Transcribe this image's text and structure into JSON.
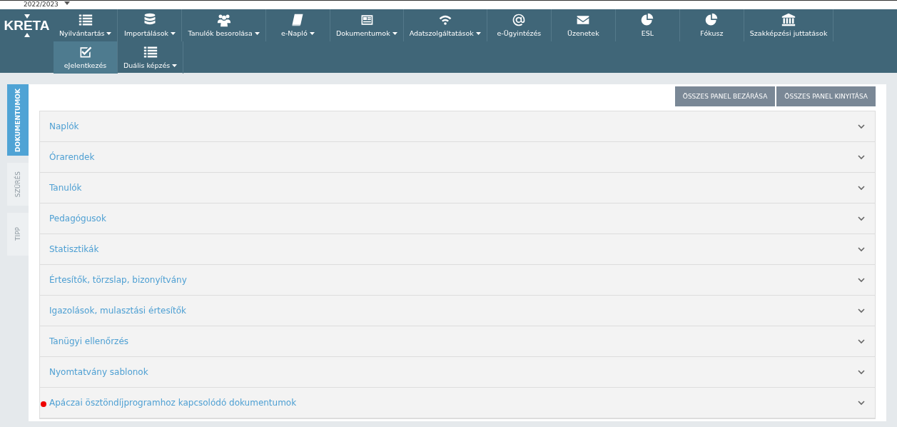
{
  "school_year": {
    "value": "2022/2023"
  },
  "logo": "KRETA",
  "menu_rows": [
    [
      {
        "label": "Nyilvántartás",
        "has_menu": true,
        "selected": false
      },
      {
        "label": "Importálások",
        "has_menu": true,
        "selected": false
      },
      {
        "label": "Tanulók besorolása",
        "has_menu": true,
        "selected": false
      },
      {
        "label": "e-Napló",
        "has_menu": true,
        "selected": false
      },
      {
        "label": "Dokumentumok",
        "has_menu": true,
        "selected": false
      },
      {
        "label": "Adatszolgáltatások",
        "has_menu": true,
        "selected": false
      },
      {
        "label": "e-Ügyintézés",
        "has_menu": false,
        "selected": false
      },
      {
        "label": "Üzenetek",
        "has_menu": false,
        "selected": false
      },
      {
        "label": "ESL",
        "has_menu": false,
        "selected": false
      },
      {
        "label": "Fókusz",
        "has_menu": false,
        "selected": false
      },
      {
        "label": "Szakképzési juttatások",
        "has_menu": false,
        "selected": false
      }
    ],
    [
      {
        "label": "eJelentkezés",
        "has_menu": false,
        "selected": true
      },
      {
        "label": "Duális képzés",
        "has_menu": true,
        "selected": false
      }
    ]
  ],
  "side_tabs": [
    {
      "label": "DOKUMENTUMOK",
      "selected": true
    },
    {
      "label": "SZŰRÉS",
      "selected": false
    },
    {
      "label": "TIPP",
      "selected": false
    }
  ],
  "buttons": [
    "ÖSSZES PANEL BEZÁRÁSA",
    "ÖSSZES PANEL KINYITÁSA"
  ],
  "panels": [
    {
      "title": "Naplók",
      "alert": false,
      "expanded": false
    },
    {
      "title": "Órarendek",
      "alert": false,
      "expanded": false
    },
    {
      "title": "Tanulók",
      "alert": false,
      "expanded": false
    },
    {
      "title": "Pedagógusok",
      "alert": false,
      "expanded": false
    },
    {
      "title": "Statisztikák",
      "alert": false,
      "expanded": false
    },
    {
      "title": "Értesítők, törzslap, bizonyítvány",
      "alert": false,
      "expanded": false
    },
    {
      "title": "Igazolások, mulasztási értesítők",
      "alert": false,
      "expanded": false
    },
    {
      "title": "Tanügyi ellenőrzés",
      "alert": false,
      "expanded": false
    },
    {
      "title": "Nyomtatvány sablonok",
      "alert": false,
      "expanded": false
    },
    {
      "title": "Apáczai ösztöndíjprogramhoz kapcsolódó dokumentumok",
      "alert": true,
      "expanded": false
    }
  ]
}
